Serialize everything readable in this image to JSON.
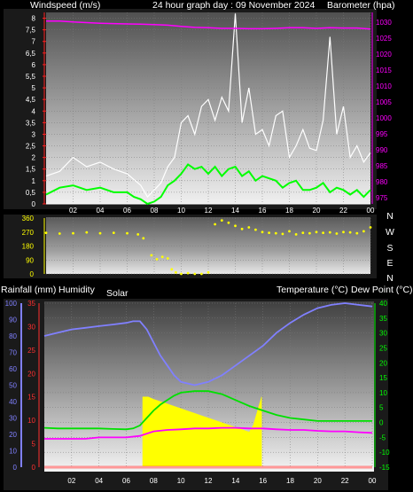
{
  "header": {
    "wind_label": "Windspeed (m/s)",
    "title": "24 hour graph day : 09 November 2024",
    "baro_label": "Barometer (hpa)"
  },
  "middle": {
    "compass_labels": [
      "N",
      "W",
      "S",
      "E",
      "N"
    ]
  },
  "bottom_header": {
    "rain_label": "Rainfall (mm)",
    "humidity_label": "Humidity",
    "solar_label": "Solar",
    "temp_label": "Temperature (°C)",
    "dew_label": "Dew Point (°C)"
  },
  "colors": {
    "wind_max": "#ffffff",
    "wind_avg": "#00ff00",
    "barometer": "#ff00ff",
    "wind_dir": "#ffff00",
    "humidity": "#8080ff",
    "temperature": "#00e000",
    "dew_point": "#ff00ff",
    "solar": "#ffff00",
    "rain": "#ff3030"
  },
  "chart_data": [
    {
      "type": "line",
      "name": "wind-baro",
      "x_ticks": [
        "02",
        "04",
        "06",
        "08",
        "10",
        "12",
        "14",
        "16",
        "18",
        "20",
        "22",
        "00"
      ],
      "y_left": {
        "label": "Windspeed (m/s)",
        "ylim": [
          0,
          8.25
        ],
        "ticks": [
          "0",
          "0,5",
          "1",
          "1,5",
          "2",
          "2,5",
          "3",
          "3,5",
          "4",
          "4,5",
          "5",
          "5,5",
          "6",
          "6,5",
          "7",
          "7,5",
          "8"
        ]
      },
      "y_right": {
        "label": "Barometer (hpa)",
        "ylim": [
          973,
          1033
        ],
        "ticks": [
          "975",
          "980",
          "985",
          "990",
          "995",
          "1000",
          "1005",
          "1010",
          "1015",
          "1020",
          "1025",
          "1030"
        ]
      },
      "series": [
        {
          "key": "wind_max",
          "x": [
            0,
            1,
            2,
            3,
            4,
            5,
            6,
            7,
            7.5,
            8,
            8.5,
            9,
            9.5,
            10,
            10.5,
            11,
            11.5,
            12,
            12.5,
            13,
            13.5,
            14,
            14.5,
            15,
            15.5,
            16,
            16.5,
            17,
            17.5,
            18,
            18.5,
            19,
            19.5,
            20,
            20.5,
            21,
            21.5,
            22,
            22.5,
            23,
            23.5,
            24
          ],
          "y": [
            1.2,
            1.4,
            2.0,
            1.6,
            1.8,
            1.5,
            1.3,
            0.8,
            0.3,
            0.6,
            0.9,
            1.6,
            2.0,
            3.5,
            3.8,
            3.0,
            4.2,
            4.5,
            3.6,
            4.6,
            4.0,
            8.2,
            3.5,
            5.0,
            3.0,
            3.2,
            2.5,
            3.8,
            4.0,
            2.0,
            2.5,
            3.2,
            2.4,
            2.3,
            3.6,
            7.2,
            3.0,
            4.2,
            2.0,
            2.5,
            1.8,
            2.2
          ]
        },
        {
          "key": "wind_avg",
          "x": [
            0,
            1,
            2,
            3,
            4,
            5,
            6,
            6.5,
            7,
            7.5,
            8,
            8.5,
            9,
            9.5,
            10,
            10.5,
            11,
            11.5,
            12,
            12.5,
            13,
            13.5,
            14,
            14.5,
            15,
            15.5,
            16,
            16.5,
            17,
            17.5,
            18,
            18.5,
            19,
            19.5,
            20,
            20.5,
            21,
            21.5,
            22,
            22.5,
            23,
            23.5,
            24
          ],
          "y": [
            0.4,
            0.7,
            0.8,
            0.6,
            0.7,
            0.5,
            0.5,
            0.3,
            0.2,
            0,
            0.1,
            0.3,
            0.8,
            1.0,
            1.3,
            1.7,
            1.5,
            1.6,
            1.3,
            1.6,
            1.2,
            1.5,
            1.6,
            1.2,
            1.4,
            1.0,
            1.2,
            1.1,
            1.0,
            0.7,
            0.9,
            1.0,
            0.6,
            0.6,
            0.7,
            0.9,
            0.5,
            0.7,
            0.6,
            0.4,
            0.6,
            0.3,
            0.6
          ]
        },
        {
          "key": "barometer",
          "axis": "right",
          "x": [
            0,
            1,
            2,
            3,
            4,
            5,
            6,
            7,
            8,
            9,
            10,
            11,
            12,
            13,
            14,
            15,
            16,
            17,
            18,
            19,
            20,
            21,
            22,
            23,
            24
          ],
          "y": [
            1030.3,
            1030.3,
            1030.0,
            1029.8,
            1029.6,
            1029.5,
            1029.4,
            1029.3,
            1029.2,
            1029.0,
            1028.6,
            1028.3,
            1028.2,
            1028.0,
            1028.0,
            1027.9,
            1027.9,
            1028.0,
            1028.2,
            1028.2,
            1028.0,
            1028.2,
            1028.1,
            1028.1,
            1027.8
          ]
        }
      ]
    },
    {
      "type": "scatter",
      "name": "wind-direction",
      "x_ticks": [
        "02",
        "04",
        "06",
        "08",
        "10",
        "12",
        "14",
        "16",
        "18",
        "20",
        "22",
        "00"
      ],
      "ylim": [
        0,
        360
      ],
      "y_ticks": [
        "0",
        "90",
        "180",
        "270",
        "360"
      ],
      "series": [
        {
          "key": "wind_dir",
          "x": [
            0,
            1,
            2,
            3,
            4,
            5,
            6,
            6.8,
            7.2,
            7.8,
            8.2,
            8.6,
            9.0,
            9.3,
            9.6,
            10,
            10.5,
            11,
            11.5,
            12,
            12.5,
            13,
            13.5,
            14,
            14.5,
            15,
            15.5,
            16,
            16.5,
            17,
            17.5,
            18,
            18.5,
            19,
            19.5,
            20,
            20.5,
            21,
            21.5,
            22,
            22.5,
            23,
            23.5,
            24
          ],
          "y": [
            265,
            260,
            262,
            268,
            262,
            265,
            262,
            255,
            230,
            120,
            95,
            110,
            100,
            30,
            10,
            0,
            5,
            0,
            0,
            10,
            320,
            345,
            330,
            310,
            290,
            300,
            285,
            270,
            265,
            262,
            258,
            275,
            255,
            265,
            262,
            270,
            265,
            268,
            260,
            270,
            268,
            262,
            275,
            300
          ]
        }
      ]
    },
    {
      "type": "line",
      "name": "temp-humidity-solar",
      "x_ticks": [
        "02",
        "04",
        "06",
        "08",
        "10",
        "12",
        "14",
        "16",
        "18",
        "20",
        "22",
        "00"
      ],
      "y_left_rain": {
        "label": "Rainfall (mm)",
        "ylim": [
          0,
          35
        ],
        "ticks": [
          "0",
          "5",
          "10",
          "15",
          "20",
          "25",
          "30",
          "35"
        ]
      },
      "y_left_humidity": {
        "label": "Humidity",
        "ylim": [
          0,
          100
        ],
        "ticks": [
          "0",
          "10",
          "20",
          "30",
          "40",
          "50",
          "60",
          "70",
          "80",
          "90",
          "100"
        ]
      },
      "y_right": {
        "label": "Temperature (°C)",
        "ylim": [
          -15,
          40
        ],
        "ticks": [
          "-15",
          "-10",
          "-5",
          "0",
          "5",
          "10",
          "15",
          "20",
          "25",
          "30",
          "35",
          "40"
        ]
      },
      "series": [
        {
          "key": "humidity",
          "x": [
            0,
            1,
            2,
            3,
            4,
            5,
            6,
            6.5,
            7,
            7.5,
            8,
            8.5,
            9,
            9.5,
            10,
            11,
            12,
            13,
            14,
            15,
            16,
            17,
            18,
            19,
            20,
            21,
            22,
            23,
            24
          ],
          "y": [
            80,
            82,
            84,
            85,
            86,
            87,
            88,
            89,
            89,
            84,
            76,
            68,
            62,
            56,
            52,
            50,
            52,
            56,
            62,
            68,
            74,
            82,
            88,
            93,
            97,
            99,
            100,
            99,
            98
          ]
        },
        {
          "key": "temperature",
          "x": [
            0,
            1,
            2,
            3,
            4,
            5,
            6,
            6.5,
            7,
            7.5,
            8,
            8.5,
            9,
            9.5,
            10,
            11,
            12,
            13,
            14,
            15,
            16,
            17,
            18,
            19,
            20,
            21,
            22,
            23,
            24
          ],
          "y": [
            -1.8,
            -2.0,
            -2.0,
            -2.0,
            -2.0,
            -2.2,
            -2.3,
            -2.0,
            -1.0,
            1.5,
            4.0,
            6.0,
            7.5,
            9.0,
            10.0,
            10.5,
            10.5,
            9.5,
            7.5,
            5.5,
            4.0,
            2.5,
            1.5,
            1.0,
            0.5,
            0.5,
            0.5,
            0.5,
            0.5
          ]
        },
        {
          "key": "dew_point",
          "x": [
            0,
            1,
            2,
            3,
            4,
            5,
            6,
            7,
            8,
            9,
            10,
            11,
            12,
            13,
            14,
            15,
            16,
            17,
            18,
            19,
            20,
            21,
            22,
            23,
            24
          ],
          "y": [
            -5.5,
            -5.5,
            -5.5,
            -5.5,
            -5.0,
            -5.0,
            -5.0,
            -4.5,
            -3.0,
            -2.5,
            -2.3,
            -2.0,
            -2.0,
            -1.8,
            -1.8,
            -2.0,
            -2.0,
            -2.3,
            -2.5,
            -2.5,
            -2.8,
            -3.0,
            -3.0,
            -3.3,
            -3.5
          ]
        },
        {
          "key": "solar",
          "axis": "rain",
          "x": [
            7.2,
            7.6,
            8,
            8.5,
            9,
            9.5,
            10,
            10.5,
            11,
            11.5,
            12,
            12.5,
            13,
            13.5,
            14,
            14.5,
            15,
            15.3,
            15.6,
            15.9
          ],
          "y": [
            15,
            15,
            14.5,
            14,
            13.5,
            13,
            12.5,
            12,
            11.5,
            11,
            10.5,
            10,
            9.5,
            9,
            8.5,
            8,
            7.5,
            9,
            12,
            15
          ]
        },
        {
          "key": "rain",
          "axis": "rain",
          "x": [
            0,
            24
          ],
          "y": [
            0,
            0
          ]
        }
      ]
    }
  ]
}
